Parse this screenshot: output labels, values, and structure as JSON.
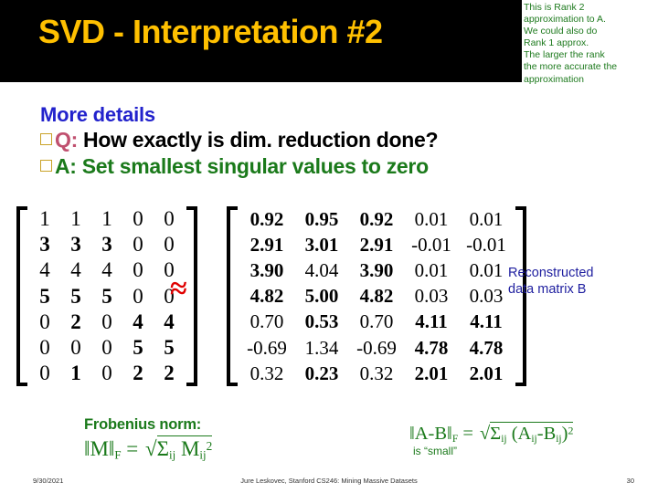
{
  "slide": {
    "title": "SVD - Interpretation #2",
    "title_color": "#ffc000",
    "title_bg": "#000000"
  },
  "note": {
    "lines": [
      "This is Rank 2",
      "approximation to A.",
      "We could  also do",
      "Rank 1 approx.",
      "The larger the rank",
      "the more accurate the",
      "approximation"
    ],
    "color": "#1e7a1e"
  },
  "bullets": {
    "lead": "More details",
    "lead_color": "#2222cc",
    "q_prefix": "Q:",
    "q_text": " How exactly is dim. reduction done?",
    "a_prefix": "A:",
    "a_text": " Set smallest singular values to zero",
    "q_prefix_color": "#c0506f",
    "a_color": "#1b7a1b"
  },
  "matrix_a": {
    "name": "original-data-matrix",
    "rows": [
      [
        "1",
        "1",
        "1",
        "0",
        "0"
      ],
      [
        "3",
        "3",
        "3",
        "0",
        "0"
      ],
      [
        "4",
        "4",
        "4",
        "0",
        "0"
      ],
      [
        "5",
        "5",
        "5",
        "0",
        "0"
      ],
      [
        "0",
        "2",
        "0",
        "4",
        "4"
      ],
      [
        "0",
        "0",
        "0",
        "5",
        "5"
      ],
      [
        "0",
        "1",
        "0",
        "2",
        "2"
      ]
    ],
    "bold": [
      [
        false,
        false,
        false,
        false,
        false
      ],
      [
        true,
        true,
        true,
        false,
        false
      ],
      [
        false,
        false,
        false,
        false,
        false
      ],
      [
        true,
        true,
        true,
        false,
        false
      ],
      [
        false,
        true,
        false,
        true,
        true
      ],
      [
        false,
        false,
        false,
        true,
        true
      ],
      [
        false,
        true,
        false,
        true,
        true
      ]
    ]
  },
  "approx_symbol": "≈",
  "approx_color": "#e00000",
  "matrix_b": {
    "name": "reconstructed-data-matrix",
    "rows": [
      [
        "0.92",
        "0.95",
        "0.92",
        "0.01",
        "0.01"
      ],
      [
        "2.91",
        "3.01",
        "2.91",
        "-0.01",
        "-0.01"
      ],
      [
        "3.90",
        "4.04",
        "3.90",
        "0.01",
        "0.01"
      ],
      [
        "4.82",
        "5.00",
        "4.82",
        "0.03",
        "0.03"
      ],
      [
        "0.70",
        "0.53",
        "0.70",
        "4.11",
        "4.11"
      ],
      [
        "-0.69",
        "1.34",
        "-0.69",
        "4.78",
        "4.78"
      ],
      [
        "0.32",
        "0.23",
        "0.32",
        "2.01",
        "2.01"
      ]
    ],
    "bold": [
      [
        true,
        true,
        true,
        false,
        false
      ],
      [
        true,
        true,
        true,
        false,
        false
      ],
      [
        true,
        false,
        true,
        false,
        false
      ],
      [
        true,
        true,
        true,
        false,
        false
      ],
      [
        false,
        true,
        false,
        true,
        true
      ],
      [
        false,
        false,
        false,
        true,
        true
      ],
      [
        false,
        true,
        false,
        true,
        true
      ]
    ]
  },
  "reconstructed_label": {
    "line1": "Reconstructed",
    "line2": "data matrix B",
    "color": "#2020a0"
  },
  "frobenius": {
    "title": "Frobenius norm:",
    "lhs": "‖M‖",
    "lhs_sub": "F",
    "eq": " = ",
    "radical": "√",
    "sigma": "Σ",
    "sigma_sub": "ij",
    "term": "M",
    "term_sub": "ij",
    "term_sup": "2"
  },
  "error_formula": {
    "lhs": "‖A-B‖",
    "lhs_sub": "F",
    "eq": " = ",
    "radical": "√",
    "sigma": "Σ",
    "sigma_sub": "ij",
    "open": " (A",
    "a_sub": "ij",
    "minus": "-B",
    "b_sub": "ij",
    "close": ")",
    "sup": "2",
    "note": "is “small”"
  },
  "footer": {
    "date": "9/30/2021",
    "center": "Jure Leskovec, Stanford CS246: Mining Massive Datasets",
    "page": "30"
  }
}
